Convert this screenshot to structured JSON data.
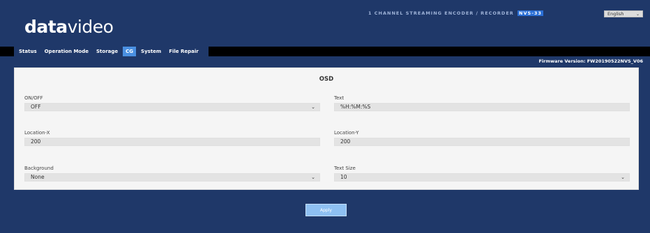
{
  "header": {
    "brand_bold": "data",
    "brand_light": "video",
    "product_title": "1 CHANNEL STREAMING ENCODER / RECORDER",
    "model": "NVS-33",
    "language": {
      "selected": "English",
      "icon": "chevron-down-icon"
    }
  },
  "nav": {
    "tabs": [
      {
        "label": "Status",
        "active": false
      },
      {
        "label": "Operation Mode",
        "active": false
      },
      {
        "label": "Storage",
        "active": false
      },
      {
        "label": "CG",
        "active": true
      },
      {
        "label": "System",
        "active": false
      },
      {
        "label": "File Repair",
        "active": false
      }
    ]
  },
  "firmware": "Firmware Version: FW20190522NVS_V06",
  "osd": {
    "title": "OSD",
    "onoff": {
      "label": "ON/OFF",
      "value": "OFF"
    },
    "text": {
      "label": "Text",
      "value": "%H:%M:%S"
    },
    "location_x": {
      "label": "Location-X",
      "value": "200"
    },
    "location_y": {
      "label": "Location-Y",
      "value": "200"
    },
    "background": {
      "label": "Background",
      "value": "None"
    },
    "text_size": {
      "label": "Text Size",
      "value": "10"
    }
  },
  "apply_label": "Apply",
  "colors": {
    "page_bg": "#1f3869",
    "active_tab": "#4a90e2",
    "apply": "#8ec0f2"
  }
}
